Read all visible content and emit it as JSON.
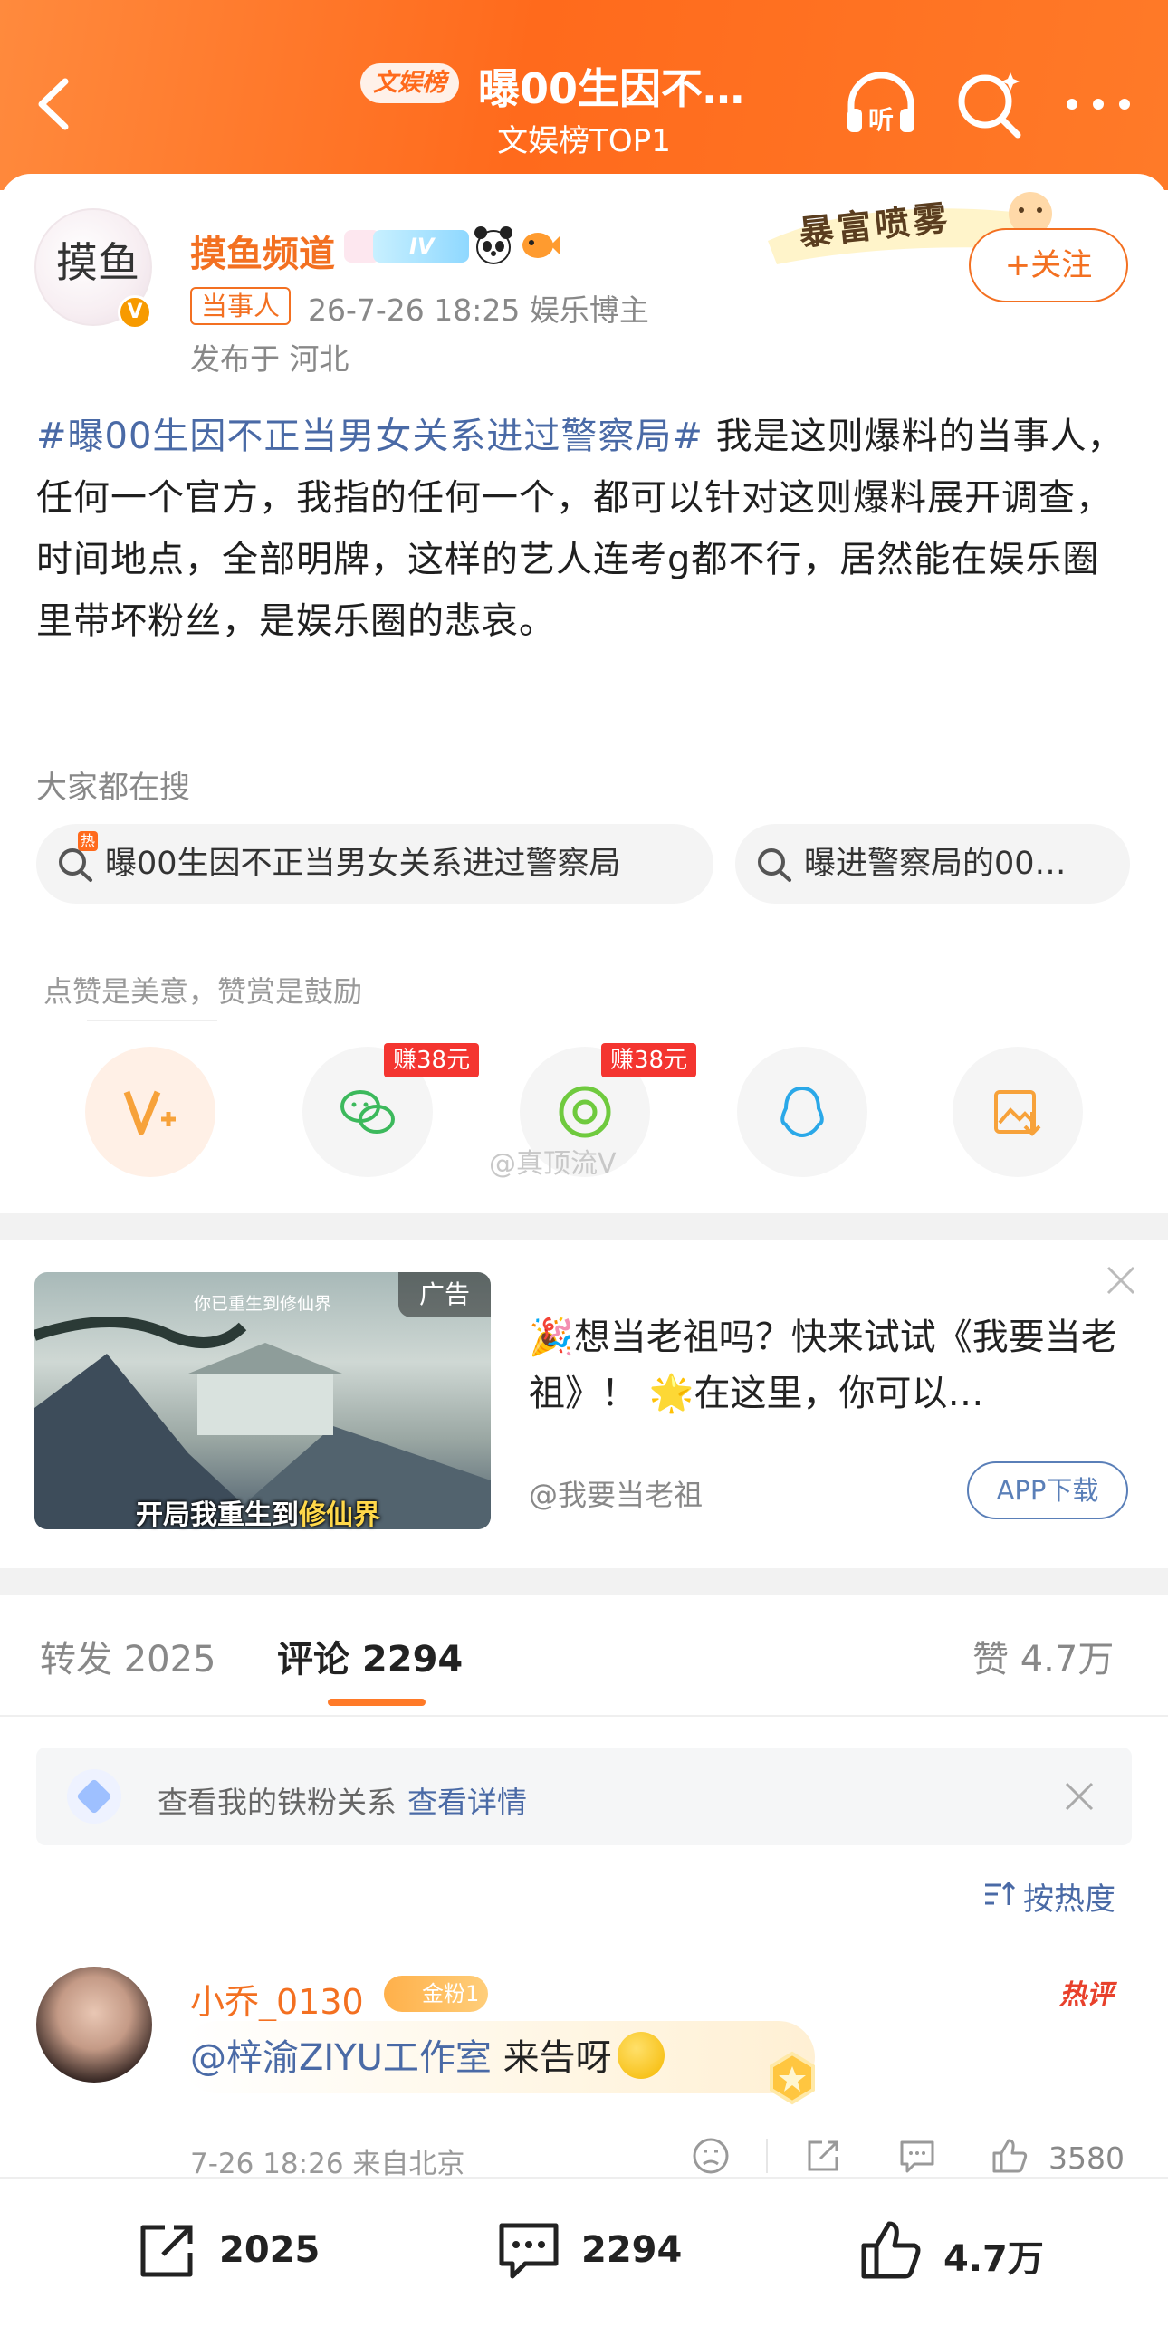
{
  "header": {
    "tag": "文娱榜",
    "title": "曝00生因不…",
    "subtitle": "文娱榜TOP1",
    "listen_label": "听"
  },
  "post": {
    "username": "摸鱼频道",
    "level_badge": "IV",
    "role_tag": "当事人",
    "meta": "26-7-26 18:25  娱乐博主",
    "location": "发布于 河北",
    "follow_label": "+关注",
    "decor_text": "暴富喷雾",
    "avatar_text": "摸鱼",
    "hashtag": "#曝00生因不正当男女关系进过警察局#",
    "body": " 我是这则爆料的当事人，任何一个官方，我指的任何一个，都可以针对这则爆料展开调查，时间地点，全部明牌，这样的艺人连考g都不行，居然能在娱乐圈里带坏粉丝，是娱乐圈的悲哀。"
  },
  "search": {
    "title": "大家都在搜",
    "hot_mark": "热",
    "items": [
      "曝00生因不正当男女关系进过警察局",
      "曝进警察局的00…"
    ]
  },
  "reward": {
    "tip": "点赞是美意，赞赏是鼓励",
    "earn_label": "赚38元",
    "watermark": "@真顶流V"
  },
  "ad": {
    "label": "广告",
    "image_top_text": "你已重生到修仙界",
    "image_caption_a": "开局我重生到",
    "image_caption_b": "修仙界",
    "text": "🎉想当老祖吗？快来试试《我要当老祖》！ 🌟在这里，你可以…",
    "author": "@我要当老祖",
    "button": "APP下载"
  },
  "tabs": {
    "repost": "转发 2025",
    "comments": "评论 2294",
    "likes": "赞 4.7万"
  },
  "fan_bar": {
    "text": "查看我的铁粉关系",
    "link": "查看详情"
  },
  "sort": {
    "label": "按热度"
  },
  "comment": {
    "username": "小乔_0130",
    "fan_badge": "金粉1",
    "hot": "热评",
    "mention": "@梓渝ZIYU工作室",
    "text": " 来告呀",
    "meta": "7-26 18:26 来自北京",
    "likes": "3580"
  },
  "bottom_bar": {
    "repost": "2025",
    "comment": "2294",
    "like": "4.7万"
  },
  "colors": {
    "header_orange": "#ff6a1c",
    "accent": "#f37021",
    "link_blue": "#4a6aa6",
    "earn_red": "#f43530"
  }
}
